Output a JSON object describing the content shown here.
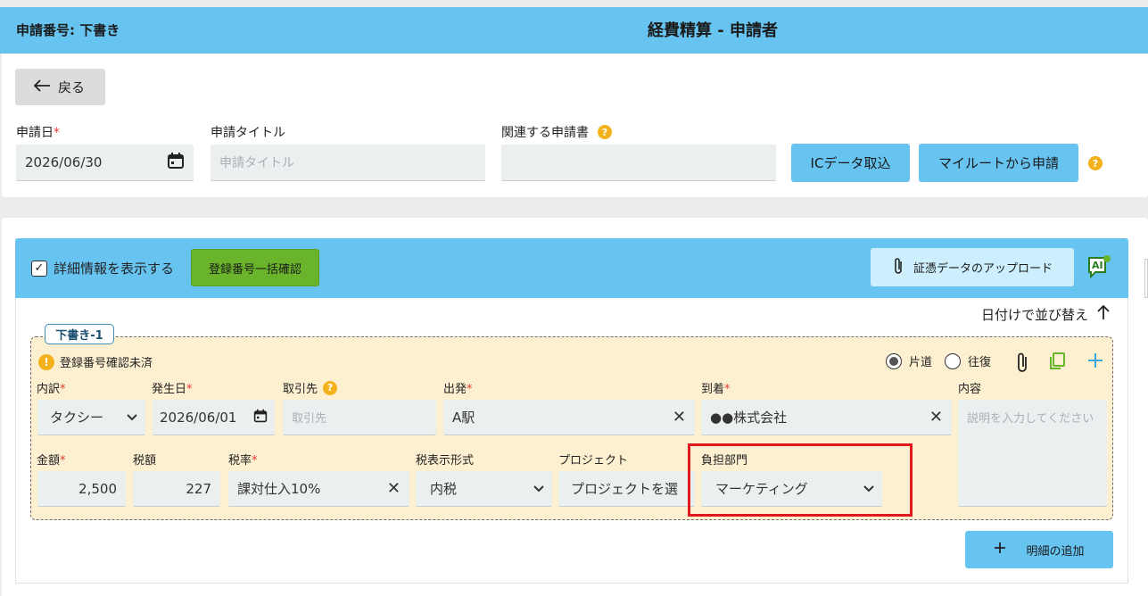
{
  "header": {
    "application_number": "申請番号: 下書き",
    "title": "経費精算 - 申請者"
  },
  "toolbar": {
    "back_label": "戻る"
  },
  "form": {
    "apply_date_label": "申請日",
    "apply_date_value": "2026/06/30",
    "title_label": "申請タイトル",
    "title_placeholder": "申請タイトル",
    "related_label": "関連する申請書",
    "ic_button": "ICデータ取込",
    "myroute_button": "マイルートから申請"
  },
  "details": {
    "show_detail_label": "詳細情報を表示する",
    "show_detail_checked": true,
    "bulk_check_button": "登録番号一括確認",
    "upload_button": "証憑データのアップロード",
    "ai_label": "AI",
    "sort_label": "日付けで並び替え",
    "add_line_button": "明細の追加"
  },
  "draft": {
    "tag": "下書き-1",
    "warning": "登録番号確認未済",
    "trip": {
      "oneway": "片道",
      "roundtrip": "往復",
      "selected": "片道"
    },
    "fields": {
      "breakdown_label": "内訳",
      "breakdown_value": "タクシー",
      "date_label": "発生日",
      "date_value": "2026/06/01",
      "client_label": "取引先",
      "client_placeholder": "取引先",
      "from_label": "出発",
      "from_value": "A駅",
      "to_label": "到着",
      "to_value": "●●株式会社",
      "content_label": "内容",
      "content_placeholder": "説明を入力してください",
      "amount_label": "金額",
      "amount_value": "2,500",
      "tax_label": "税額",
      "tax_value": "227",
      "taxrate_label": "税率",
      "taxrate_value": "課対仕入10%",
      "taxformat_label": "税表示形式",
      "taxformat_value": "内税",
      "project_label": "プロジェクト",
      "project_value": "プロジェクトを選",
      "dept_label": "負担部門",
      "dept_value": "マーケティング"
    }
  },
  "required_mark": "*",
  "colors": {
    "header": "#67c4f1",
    "draft_bg": "#fdf0d1",
    "highlight": "#e0191f",
    "green": "#6ab42b"
  }
}
